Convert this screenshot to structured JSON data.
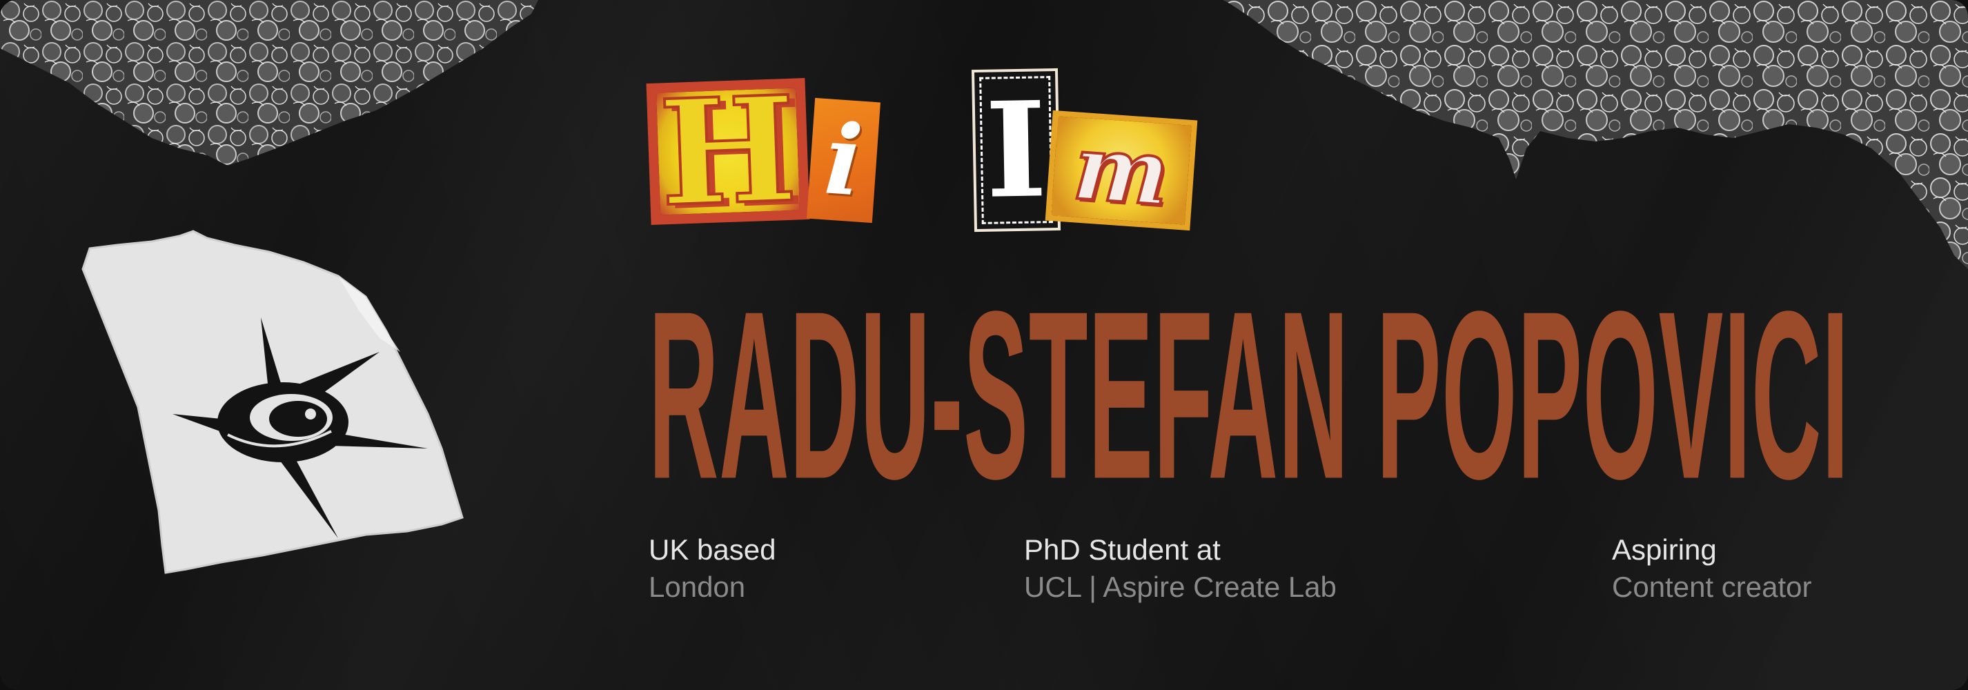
{
  "greeting": {
    "letters": [
      "H",
      "i",
      "I",
      "m"
    ]
  },
  "name": "RADU-STEFAN POPOVICI",
  "info": [
    {
      "label": "UK based",
      "value": "London"
    },
    {
      "label": "PhD Student at",
      "value": "UCL | Aspire Create Lab"
    },
    {
      "label": "Aspiring",
      "value": "Content creator"
    }
  ],
  "colors": {
    "background": "#121212",
    "name": "#9b4b2a",
    "label": "#e6e6e6",
    "value": "#8a8a8a"
  },
  "icons": {
    "paper_emblem": "eye-sun-emblem-icon"
  }
}
